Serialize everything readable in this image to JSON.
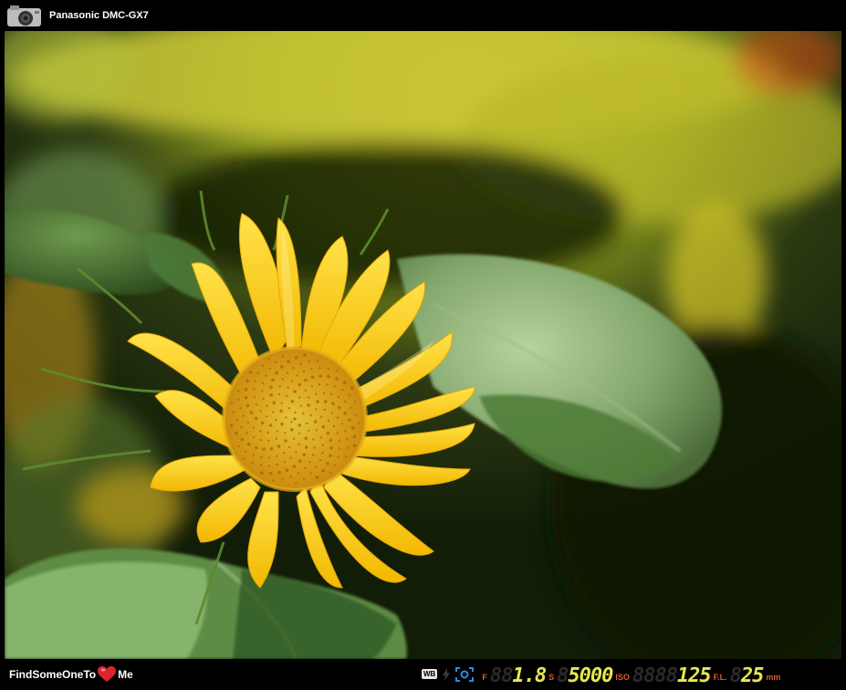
{
  "header": {
    "camera_model": "Panasonic DMC-GX7",
    "camera_icon": "camera-icon"
  },
  "photo": {
    "subject_icon": "sunflower-photo"
  },
  "footer": {
    "brand_text_left": "FindSomeOneTo",
    "brand_text_right": "Me",
    "brand_icon": "heart-icon",
    "wb_label": "WB",
    "flash_icon": "flash-icon",
    "metering_icon": "metering-icon",
    "aperture_label": "F",
    "aperture_ghost": "88",
    "aperture_value": "1.8",
    "shutter_label": "S",
    "shutter_ghost": "8",
    "shutter_value": "5000",
    "iso_label": "ISO",
    "iso_ghost": "8888",
    "iso_value": "125",
    "focal_label": "F.L.",
    "focal_ghost": "8",
    "focal_value": "25",
    "focal_unit": "mm"
  },
  "colors": {
    "label_orange": "#e05a2a",
    "lcd_yellow": "#e8e84a",
    "meter_blue": "#2a8ae0"
  }
}
